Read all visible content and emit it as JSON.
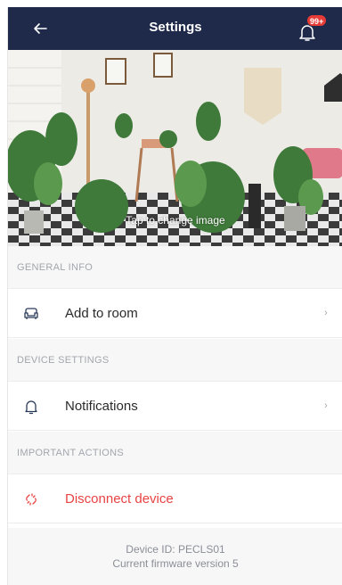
{
  "header": {
    "title": "Settings",
    "notification_badge": "99+"
  },
  "hero": {
    "caption": "Tap to change image"
  },
  "sections": {
    "general": {
      "label": "GENERAL INFO",
      "add_room": "Add to room"
    },
    "device": {
      "label": "DEVICE SETTINGS",
      "notifications": "Notifications"
    },
    "actions": {
      "label": "IMPORTANT ACTIONS",
      "disconnect": "Disconnect device"
    }
  },
  "footer": {
    "device_id": "Device ID: PECLS01",
    "firmware": "Current firmware version 5"
  },
  "colors": {
    "header_bg": "#1f2a4b",
    "danger": "#e84343",
    "badge": "#e63b36"
  },
  "icons": [
    "back-arrow-icon",
    "bell-icon",
    "sofa-icon",
    "bell-outline-icon",
    "broken-link-icon",
    "chevron-right-icon"
  ]
}
